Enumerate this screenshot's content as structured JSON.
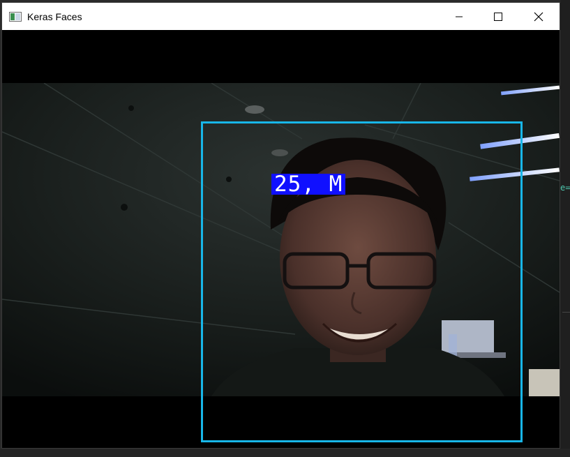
{
  "window": {
    "title": "Keras Faces",
    "icon": "window-app-icon",
    "controls": [
      "minimize-icon",
      "maximize-icon",
      "close-icon"
    ]
  },
  "detection": {
    "label": "25, M",
    "box_color": "#18b6e8",
    "label_bg": "#1010ff"
  },
  "background": {
    "right_text": "e="
  }
}
